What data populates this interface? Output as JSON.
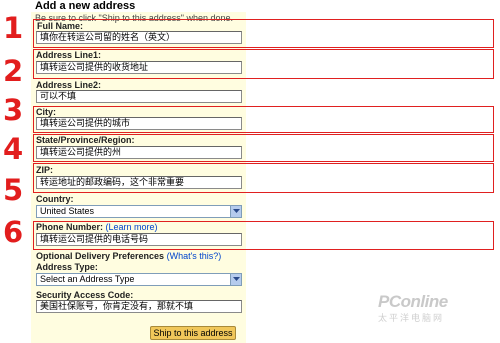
{
  "form": {
    "title": "Add a new address",
    "instruction": "Be sure to click \"Ship to this address\" when done.",
    "full_name": {
      "label": "Full Name:",
      "value": "填你在转运公司留的姓名（英文）"
    },
    "address1": {
      "label": "Address Line1:",
      "value": "填转运公司提供的收货地址"
    },
    "address2": {
      "label": "Address Line2:",
      "value": "可以不填"
    },
    "city": {
      "label": "City:",
      "value": "填转运公司提供的城市"
    },
    "state": {
      "label": "State/Province/Region:",
      "value": "填转运公司提供的州"
    },
    "zip": {
      "label": "ZIP:",
      "value": "转运地址的邮政编码，这个非常重要"
    },
    "country": {
      "label": "Country:",
      "value": "United States"
    },
    "phone": {
      "label": "Phone Number:",
      "link": "(Learn more)",
      "value": "填转运公司提供的电话号码"
    },
    "delivery_prefs": {
      "label": "Optional Delivery Preferences",
      "link": "(What's this?)"
    },
    "address_type": {
      "label": "Address Type:",
      "value": "Select an Address Type"
    },
    "security_code": {
      "label": "Security Access Code:",
      "value": "美国社保账号，你肯定没有，那就不填"
    },
    "submit_label": "Ship to this address"
  },
  "annotations": {
    "step_numbers": [
      "1",
      "2",
      "3",
      "4",
      "5",
      "6"
    ],
    "color": "#e21d1d"
  },
  "watermark": {
    "logo": "PConline",
    "tagline": "太平洋电脑网"
  }
}
